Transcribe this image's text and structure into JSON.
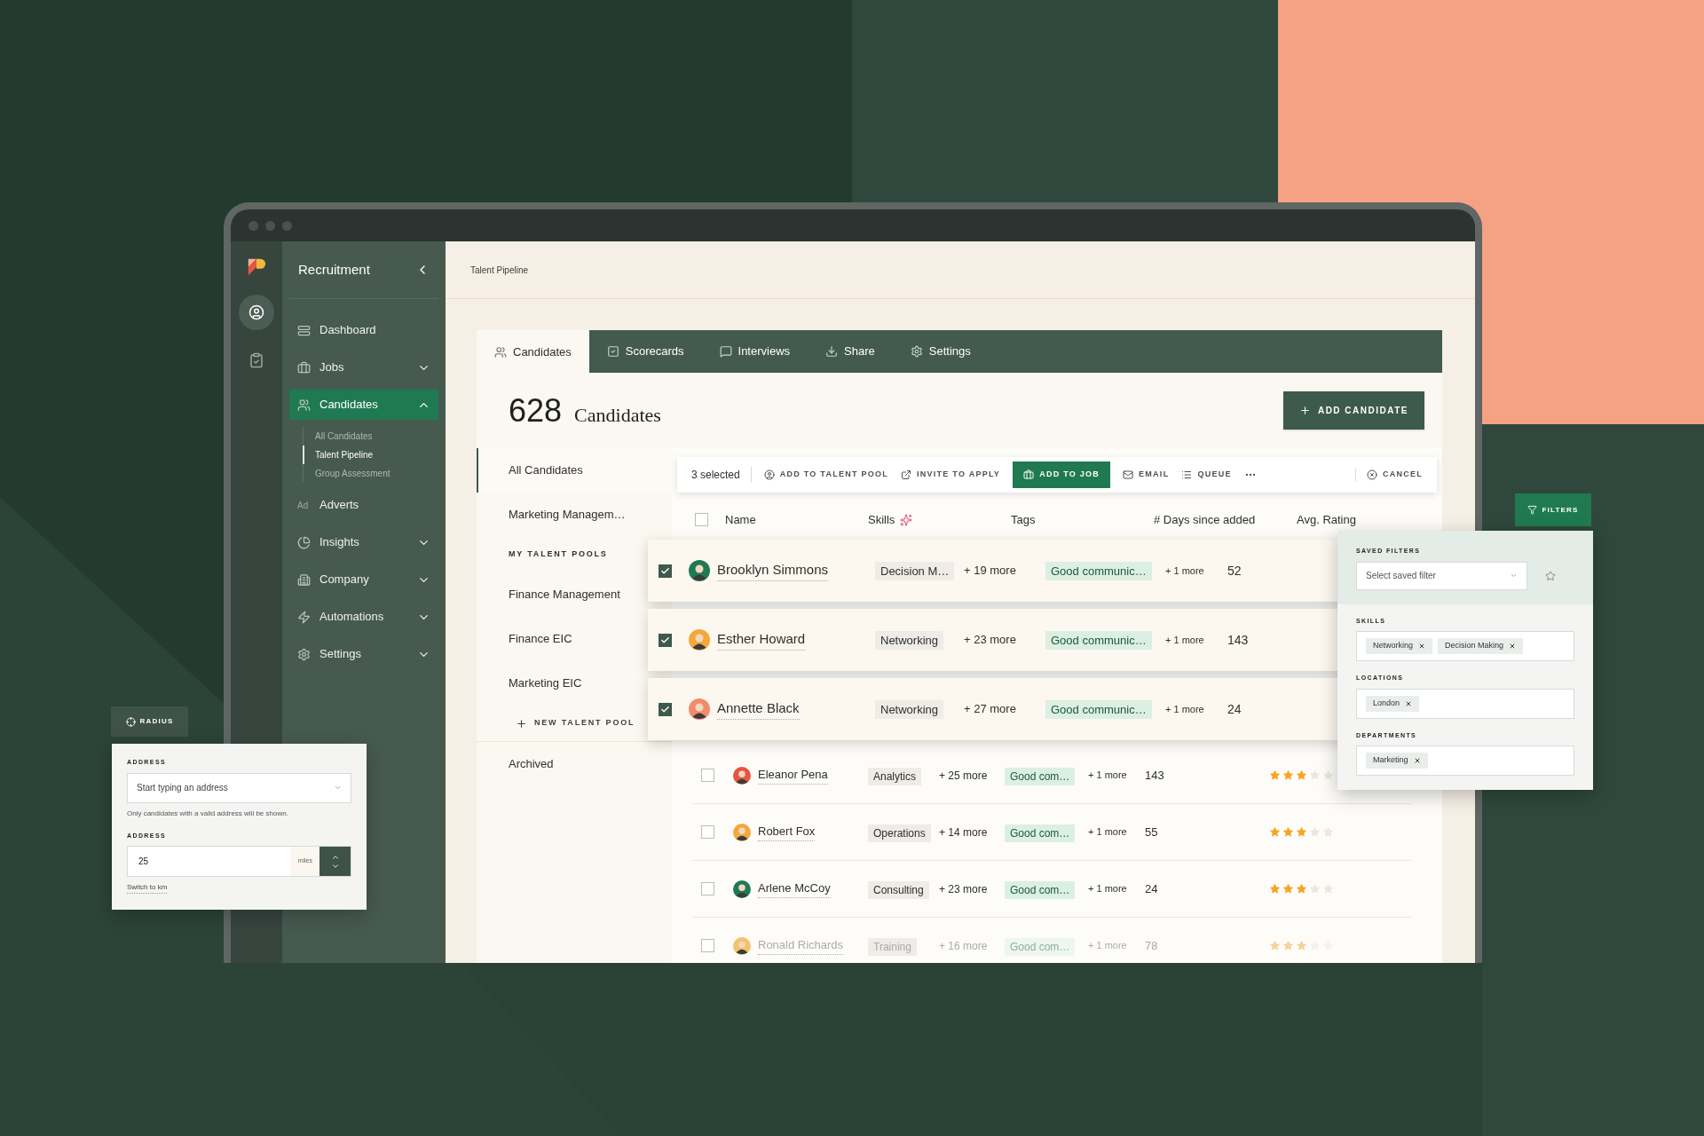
{
  "rail": [
    {
      "selected": true
    },
    {
      "selected": false
    }
  ],
  "sidebar": {
    "title": "Recruitment",
    "items": [
      {
        "label": "Dashboard",
        "selected": false
      },
      {
        "label": "Jobs",
        "selected": false,
        "expanded": false
      },
      {
        "label": "Candidates",
        "selected": true,
        "expanded": true,
        "children": [
          {
            "label": "All Candidates",
            "selected": false
          },
          {
            "label": "Talent Pipeline",
            "selected": true
          },
          {
            "label": "Group Assessment",
            "selected": false
          }
        ]
      },
      {
        "label": "Adverts",
        "selected": false,
        "icon_text": "Ad"
      },
      {
        "label": "Insights",
        "selected": false,
        "expanded": false
      },
      {
        "label": "Company",
        "selected": false,
        "expanded": false
      },
      {
        "label": "Automations",
        "selected": false,
        "expanded": false
      },
      {
        "label": "Settings",
        "selected": false,
        "expanded": false
      }
    ]
  },
  "breadcrumb": "Talent Pipeline",
  "tabs": [
    {
      "label": "Candidates",
      "selected": true
    },
    {
      "label": "Scorecards",
      "selected": false
    },
    {
      "label": "Interviews",
      "selected": false
    },
    {
      "label": "Share",
      "selected": false
    },
    {
      "label": "Settings",
      "selected": false
    }
  ],
  "heading": {
    "count": "628",
    "label": "Candidates",
    "button": "ADD CANDIDATE"
  },
  "pools": {
    "views": [
      {
        "label": "All Candidates",
        "selected": true
      },
      {
        "label": "Marketing Managem…",
        "selected": false
      }
    ],
    "section_title": "MY TALENT POOLS",
    "my_pools": [
      "Finance Management",
      "Finance EIC",
      "Marketing EIC"
    ],
    "new_pool": "NEW TALENT POOL",
    "archived": "Archived"
  },
  "bulk_bar": {
    "count": "3 selected",
    "actions": [
      {
        "label": "ADD TO TALENT POOL",
        "primary": false
      },
      {
        "label": "INVITE TO APPLY",
        "primary": false
      },
      {
        "label": "ADD TO JOB",
        "primary": true
      },
      {
        "label": "EMAIL",
        "primary": false
      },
      {
        "label": "QUEUE",
        "primary": false
      }
    ],
    "cancel": "CANCEL"
  },
  "table": {
    "all_checked": false,
    "columns": [
      "Name",
      "Skills",
      "Tags",
      "# Days since added",
      "Avg. Rating"
    ],
    "rows": [
      {
        "name": "Brooklyn Simmons",
        "skill": "Decision M…",
        "skills_more": "+ 19 more",
        "tag": "Good communic…",
        "tags_more": "+ 1 more",
        "days": "52",
        "selected": true,
        "faded": false,
        "color": "#1f7a52"
      },
      {
        "name": "Esther Howard",
        "skill": "Networking",
        "skills_more": "+ 23 more",
        "tag": "Good communic…",
        "tags_more": "+ 1 more",
        "days": "143",
        "selected": true,
        "faded": false,
        "color": "#f2a93b"
      },
      {
        "name": "Annette Black",
        "skill": "Networking",
        "skills_more": "+ 27 more",
        "tag": "Good communic…",
        "tags_more": "+ 1 more",
        "days": "24",
        "selected": true,
        "faded": false,
        "color": "#f08b6b"
      },
      {
        "name": "Eleanor Pena",
        "skill": "Analytics",
        "skills_more": "+ 25 more",
        "tag": "Good com…",
        "tags_more": "+ 1 more",
        "days": "143",
        "stars": 3,
        "selected": false,
        "faded": false,
        "color": "#e8553f"
      },
      {
        "name": "Robert Fox",
        "skill": "Operations",
        "skills_more": "+ 14 more",
        "tag": "Good com…",
        "tags_more": "+ 1 more",
        "days": "55",
        "stars": 3,
        "selected": false,
        "faded": false,
        "color": "#f2a93b"
      },
      {
        "name": "Arlene McCoy",
        "skill": "Consulting",
        "skills_more": "+ 23 more",
        "tag": "Good com…",
        "tags_more": "+ 1 more",
        "days": "24",
        "stars": 3,
        "selected": false,
        "faded": false,
        "color": "#1f7a52"
      },
      {
        "name": "Ronald Richards",
        "skill": "Training",
        "skills_more": "+ 16 more",
        "tag": "Good com…",
        "tags_more": "+ 1 more",
        "days": "78",
        "stars": 3,
        "selected": false,
        "faded": true,
        "color": "#f2c36b"
      }
    ]
  },
  "filters": {
    "button": "FILTERS",
    "saved_label": "SAVED FILTERS",
    "saved_placeholder": "Select saved filter",
    "groups": [
      {
        "label": "SKILLS",
        "chips": [
          "Networking",
          "Decision Making"
        ]
      },
      {
        "label": "LOCATIONS",
        "chips": [
          "London"
        ]
      },
      {
        "label": "DEPARTMENTS",
        "chips": [
          "Marketing"
        ]
      }
    ]
  },
  "radius": {
    "button": "RADIUS",
    "address_label": "ADDRESS",
    "address_placeholder": "Start typing an address",
    "hint": "Only candidates with a valid address will be shown.",
    "distance_label": "ADDRESS",
    "distance": "25",
    "unit": "miles",
    "switch_link": "Switch to km"
  }
}
